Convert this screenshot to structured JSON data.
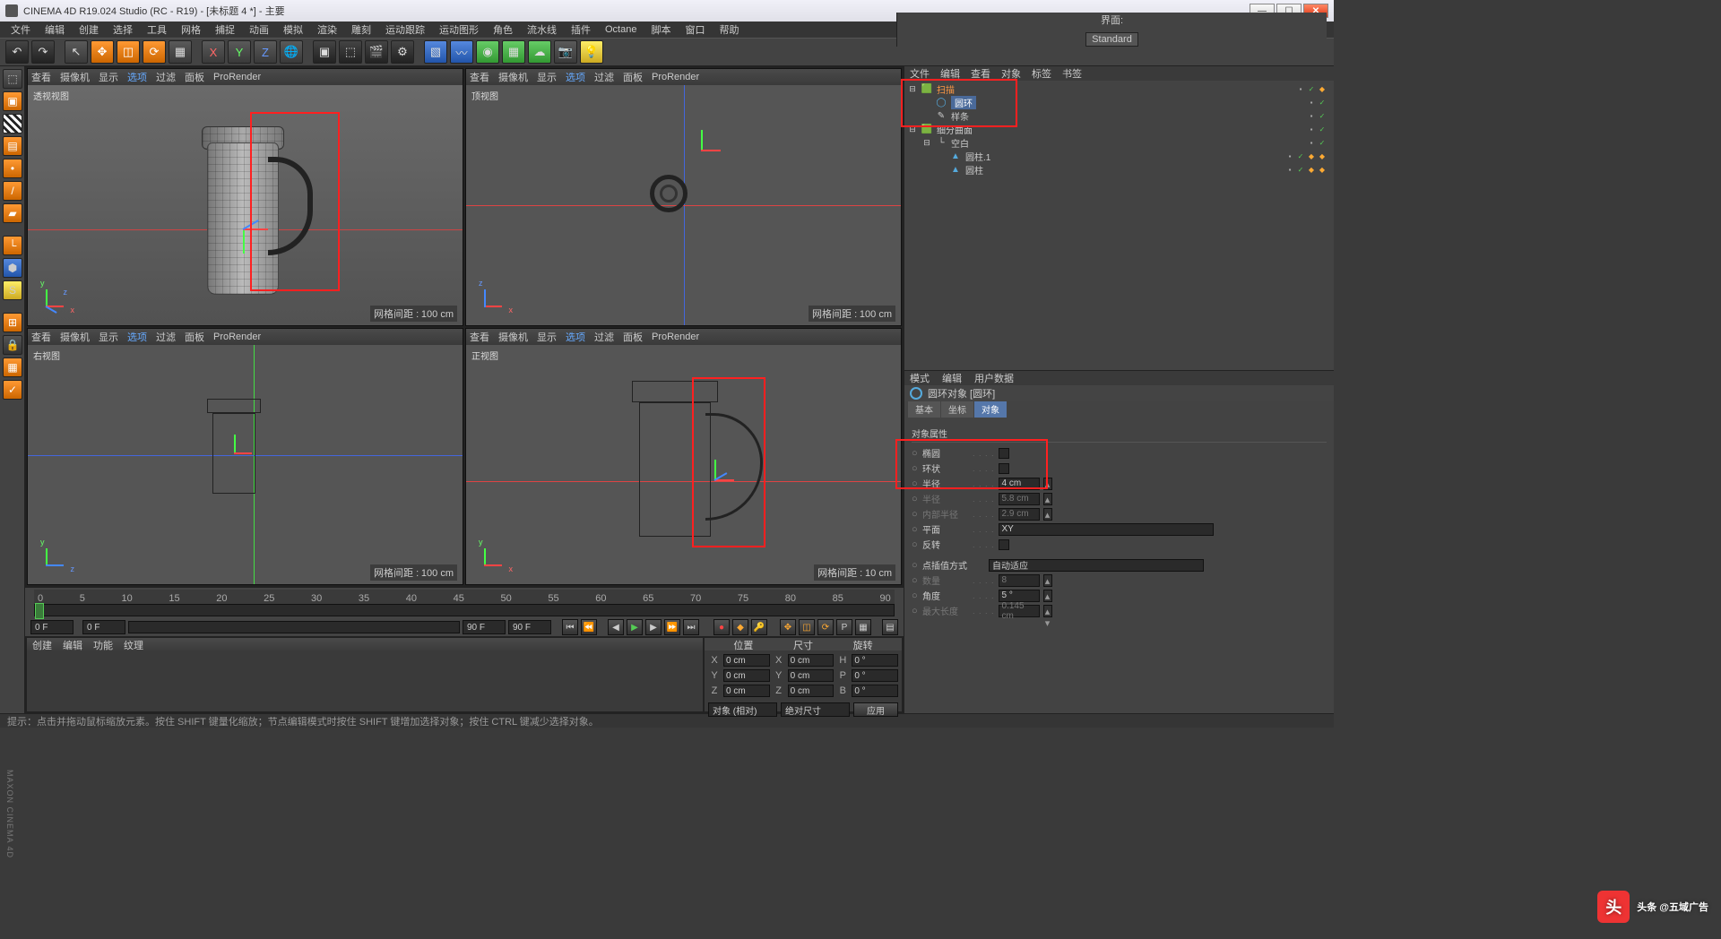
{
  "title": "CINEMA 4D R19.024 Studio (RC - R19) - [未标题 4 *] - 主要",
  "menubar": [
    "文件",
    "编辑",
    "创建",
    "选择",
    "工具",
    "网格",
    "捕捉",
    "动画",
    "模拟",
    "渲染",
    "雕刻",
    "运动跟踪",
    "运动图形",
    "角色",
    "流水线",
    "插件",
    "Octane",
    "脚本",
    "窗口",
    "帮助"
  ],
  "layout_label": "界面:",
  "layout_value": "Standard",
  "vp_menu": [
    "查看",
    "摄像机",
    "显示",
    "选项",
    "过滤",
    "面板",
    "ProRender"
  ],
  "view_labels": {
    "persp": "透视视图",
    "top": "顶视图",
    "right": "右视图",
    "front": "正视图"
  },
  "grid_label": "网格间距 :",
  "grid_values": {
    "persp": "100 cm",
    "top": "100 cm",
    "right": "100 cm",
    "front": "10 cm"
  },
  "axis_lbl": {
    "x": "x",
    "y": "y",
    "z": "z"
  },
  "timeline": {
    "start": 0,
    "end": 90,
    "ticks": [
      0,
      5,
      10,
      15,
      20,
      25,
      30,
      35,
      40,
      45,
      50,
      55,
      60,
      65,
      70,
      75,
      80,
      85,
      90
    ],
    "cur": "0 F",
    "min": "0 F",
    "max1": "90 F",
    "max2": "90 F"
  },
  "coord": {
    "headers": [
      "位置",
      "尺寸",
      "旋转"
    ],
    "rows": [
      {
        "a": "X",
        "p": "0 cm",
        "s": "0 cm",
        "r": "H",
        "rv": "0 °"
      },
      {
        "a": "Y",
        "p": "0 cm",
        "s": "0 cm",
        "r": "P",
        "rv": "0 °"
      },
      {
        "a": "Z",
        "p": "0 cm",
        "s": "0 cm",
        "r": "B",
        "rv": "0 °"
      }
    ],
    "mode": "对象 (相对)",
    "size_mode": "绝对尺寸",
    "apply": "应用"
  },
  "matmenu": [
    "创建",
    "编辑",
    "功能",
    "纹理"
  ],
  "objmenu": [
    "文件",
    "编辑",
    "查看",
    "对象",
    "标签",
    "书签"
  ],
  "objtree": [
    {
      "d": 0,
      "exp": "⊟",
      "ic": "🟩",
      "nm": "扫描",
      "cls": "or",
      "tags": [
        "x",
        "g",
        "o"
      ]
    },
    {
      "d": 1,
      "exp": "",
      "ic": "◯",
      "nm": "圆环",
      "sel": true,
      "tags": [
        "x",
        "g"
      ]
    },
    {
      "d": 1,
      "exp": "",
      "ic": "✎",
      "nm": "样条",
      "tags": [
        "x",
        "g"
      ]
    },
    {
      "d": 0,
      "exp": "⊟",
      "ic": "🟩",
      "nm": "细分曲面",
      "tags": [
        "x",
        "g"
      ]
    },
    {
      "d": 1,
      "exp": "⊟",
      "ic": "└",
      "nm": "空白",
      "tags": [
        "x",
        "g"
      ]
    },
    {
      "d": 2,
      "exp": "",
      "ic": "▲",
      "nm": "圆柱.1",
      "tags": [
        "x",
        "g",
        "o",
        "o"
      ]
    },
    {
      "d": 2,
      "exp": "",
      "ic": "▲",
      "nm": "圆柱",
      "tags": [
        "x",
        "g",
        "o",
        "o"
      ]
    }
  ],
  "attrmenu": [
    "模式",
    "编辑",
    "用户数据"
  ],
  "attr_title": "圆环对象 [圆环]",
  "attr_tabs": [
    "基本",
    "坐标",
    "对象"
  ],
  "attr_section": "对象属性",
  "attr_rows": [
    {
      "lbl": "椭圆",
      "type": "chk"
    },
    {
      "lbl": "环状",
      "type": "chk"
    },
    {
      "lbl": "半径",
      "type": "num",
      "val": "4 cm"
    },
    {
      "lbl": "半径",
      "type": "num",
      "val": "5.8 cm",
      "dim": true
    },
    {
      "lbl": "内部半径",
      "type": "num",
      "val": "2.9 cm",
      "dim": true
    },
    {
      "lbl": "平面",
      "type": "sel",
      "val": "XY"
    },
    {
      "lbl": "反转",
      "type": "chk"
    }
  ],
  "attr_interp_lbl": "点插值方式",
  "attr_interp_val": "自动适应",
  "attr_rows2": [
    {
      "lbl": "数量",
      "type": "num",
      "val": "8",
      "dim": true
    },
    {
      "lbl": "角度",
      "type": "num",
      "val": "5 °"
    },
    {
      "lbl": "最大长度",
      "type": "num",
      "val": "0.145 cm",
      "dim": true
    }
  ],
  "status": "提示：点击并拖动鼠标缩放元素。按住 SHIFT 键量化缩放；节点编辑模式时按住 SHIFT 键增加选择对象；按住 CTRL 键减少选择对象。",
  "watermark": "头条 @五域广告",
  "sidetext": "MAXON CINEMA 4D"
}
